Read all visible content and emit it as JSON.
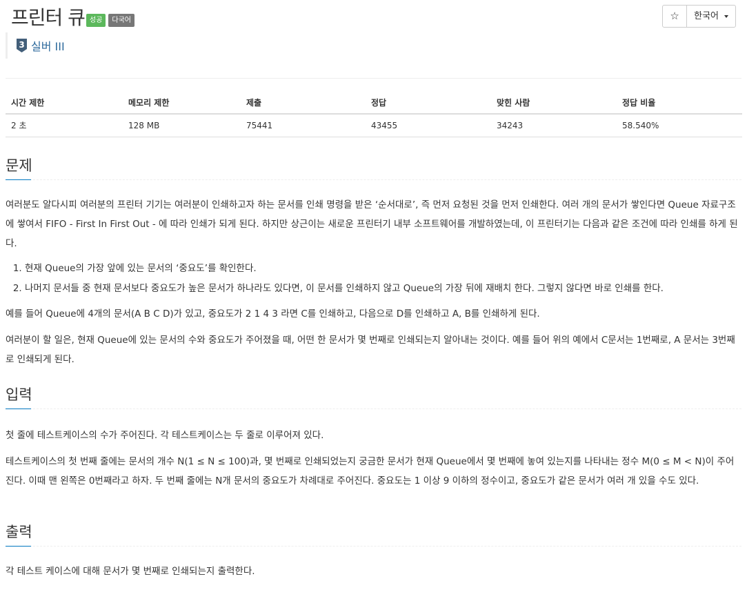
{
  "header": {
    "title": "프린터 큐",
    "badges": {
      "success": "성공",
      "multi": "다국어"
    },
    "star_glyph": "☆",
    "language": "한국어",
    "tier": {
      "number": "3",
      "label": "실버 III",
      "color": "#2d6a9c"
    }
  },
  "info_table": {
    "headers": [
      "시간 제한",
      "메모리 제한",
      "제출",
      "정답",
      "맞힌 사람",
      "정답 비율"
    ],
    "values": [
      "2 초",
      "128 MB",
      "75441",
      "43455",
      "34243",
      "58.540%"
    ]
  },
  "problem": {
    "title": "문제",
    "p1": "여러분도 알다시피 여러분의 프린터 기기는 여러분이 인쇄하고자 하는 문서를 인쇄 명령을 받은 ‘순서대로’, 즉 먼저 요청된 것을 먼저 인쇄한다. 여러 개의 문서가 쌓인다면 Queue 자료구조에 쌓여서 FIFO - First In First Out - 에 따라 인쇄가 되게 된다. 하지만 상근이는 새로운 프린터기 내부 소프트웨어를 개발하였는데, 이 프린터기는 다음과 같은 조건에 따라 인쇄를 하게 된다.",
    "steps": [
      "현재 Queue의 가장 앞에 있는 문서의 ‘중요도’를 확인한다.",
      "나머지 문서들 중 현재 문서보다 중요도가 높은 문서가 하나라도 있다면, 이 문서를 인쇄하지 않고 Queue의 가장 뒤에 재배치 한다. 그렇지 않다면 바로 인쇄를 한다."
    ],
    "p2": "예를 들어 Queue에 4개의 문서(A B C D)가 있고, 중요도가 2 1 4 3 라면 C를 인쇄하고, 다음으로 D를 인쇄하고 A, B를 인쇄하게 된다.",
    "p3": "여러분이 할 일은, 현재 Queue에 있는 문서의 수와 중요도가 주어졌을 때, 어떤 한 문서가 몇 번째로 인쇄되는지 알아내는 것이다. 예를 들어 위의 예에서 C문서는 1번째로, A 문서는 3번째로 인쇄되게 된다."
  },
  "input": {
    "title": "입력",
    "p1": "첫 줄에 테스트케이스의 수가 주어진다. 각 테스트케이스는 두 줄로 이루어져 있다.",
    "p2": "테스트케이스의 첫 번째 줄에는 문서의 개수 N(1 ≤ N ≤ 100)과, 몇 번째로 인쇄되었는지 궁금한 문서가 현재 Queue에서 몇 번째에 놓여 있는지를 나타내는 정수 M(0 ≤ M < N)이 주어진다. 이때 맨 왼쪽은 0번째라고 하자. 두 번째 줄에는 N개 문서의 중요도가 차례대로 주어진다. 중요도는 1 이상 9 이하의 정수이고, 중요도가 같은 문서가 여러 개 있을 수도 있다."
  },
  "output": {
    "title": "출력",
    "p1": "각 테스트 케이스에 대해 문서가 몇 번째로 인쇄되는지 출력한다."
  },
  "colors": {
    "success": "#5cb85c",
    "multi": "#777777",
    "accent": "#0076c0",
    "tier": "#2d6a9c"
  }
}
